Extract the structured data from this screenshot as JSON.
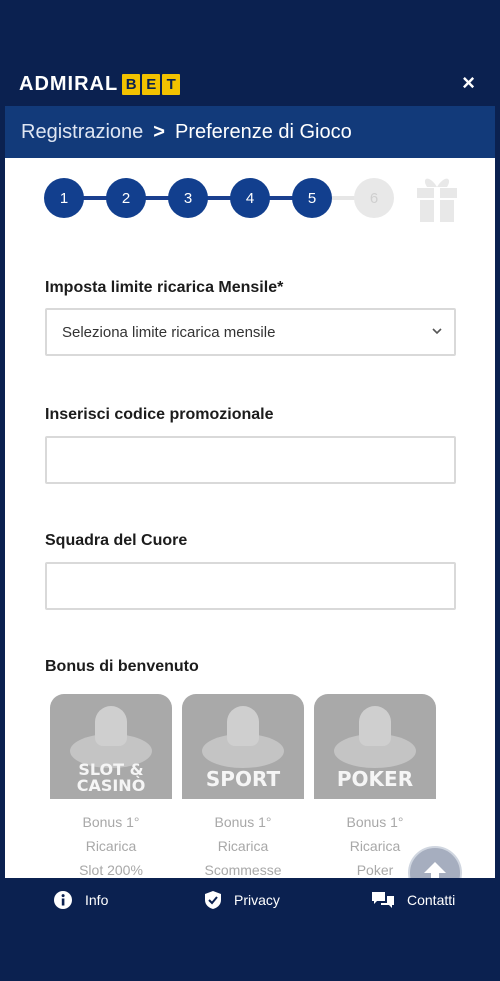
{
  "header": {
    "logo_word": "ADMIRAL",
    "logo_letters": [
      "B",
      "E",
      "T"
    ],
    "close_label": "×"
  },
  "breadcrumb": {
    "parent": "Registrazione",
    "separator": ">",
    "current": "Preferenze di Gioco"
  },
  "stepper": {
    "steps": [
      "1",
      "2",
      "3",
      "4",
      "5",
      "6"
    ],
    "active_count": 5,
    "final_icon": "gift-icon"
  },
  "form": {
    "limit_label": "Imposta limite ricarica Mensile*",
    "limit_select_value": "Seleziona limite ricarica mensile",
    "promo_label": "Inserisci codice promozionale",
    "promo_value": "",
    "team_label": "Squadra del Cuore",
    "team_value": ""
  },
  "bonus": {
    "title": "Bonus di benvenuto",
    "cards": [
      {
        "title_1": "SLOT &",
        "title_2": "CASINÒ",
        "line_1": "Bonus 1°",
        "line_2": "Ricarica",
        "line_3": "Slot 200%"
      },
      {
        "title_1": "SPORT",
        "title_2": "",
        "line_1": "Bonus 1°",
        "line_2": "Ricarica",
        "line_3": "Scommesse"
      },
      {
        "title_1": "POKER",
        "title_2": "",
        "line_1": "Bonus 1°",
        "line_2": "Ricarica",
        "line_3": "Poker"
      }
    ]
  },
  "footer": {
    "info_label": "Info",
    "privacy_label": "Privacy",
    "contact_label": "Contatti"
  },
  "colors": {
    "navy": "#0b2150",
    "breadcrumb_bg": "#123a7a",
    "step_active": "#123f8e",
    "logo_yellow": "#f2c200"
  }
}
